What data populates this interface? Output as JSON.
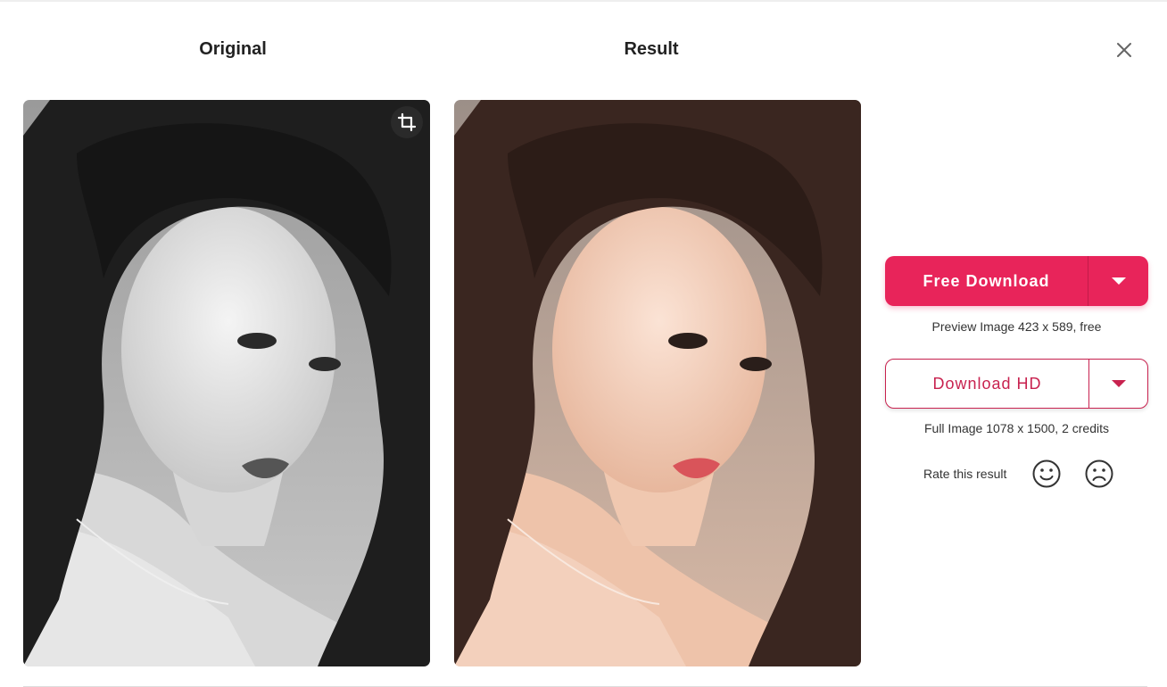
{
  "columns": {
    "original_title": "Original",
    "result_title": "Result"
  },
  "icons": {
    "close": "close-icon",
    "crop": "crop-icon",
    "dropdown": "caret-down-icon",
    "happy": "smiley-face-icon",
    "sad": "sad-face-icon"
  },
  "free_download": {
    "label": "Free Download",
    "caption": "Preview Image 423 x 589, free"
  },
  "download_hd": {
    "label": "Download HD",
    "caption": "Full Image 1078 x 1500, 2 credits"
  },
  "rating": {
    "label": "Rate this result"
  },
  "colors": {
    "accent": "#e8245a",
    "accent_outline": "#c8224f",
    "title_text": "#222222",
    "body_text": "#333333"
  }
}
